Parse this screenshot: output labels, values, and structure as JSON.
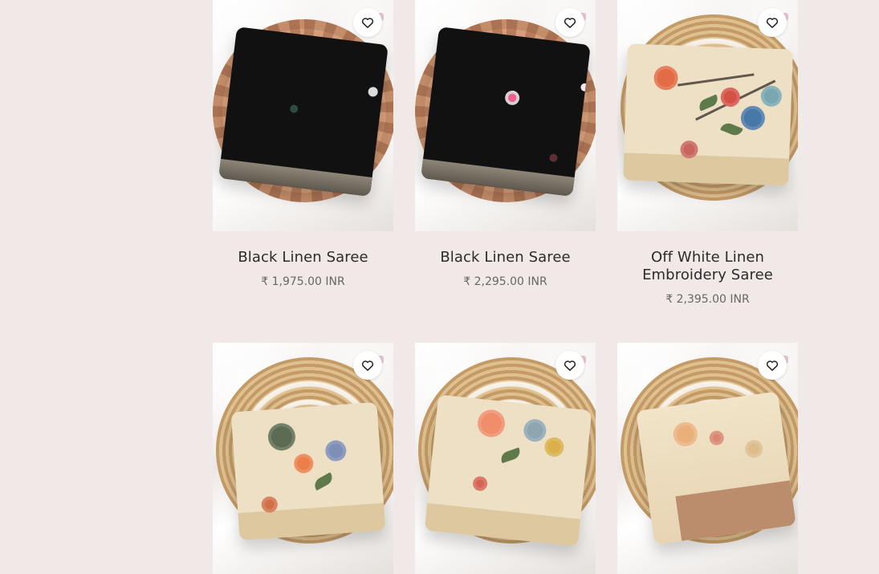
{
  "products": [
    {
      "name": "Black Linen Saree",
      "price": "₹ 1,975.00 INR",
      "wishlist_icon": "heart-outline-icon"
    },
    {
      "name": "Black Linen Saree",
      "price": "₹ 2,295.00 INR",
      "wishlist_icon": "heart-outline-icon"
    },
    {
      "name": "Off White Linen Embroidery Saree",
      "price": "₹ 2,395.00 INR",
      "wishlist_icon": "heart-outline-icon"
    },
    {
      "wishlist_icon": "heart-outline-icon"
    },
    {
      "wishlist_icon": "heart-outline-icon"
    },
    {
      "wishlist_icon": "heart-outline-icon"
    }
  ],
  "colors": {
    "page_background": "#f1e8e8",
    "text_primary": "#2e2a2a",
    "text_secondary": "#6a6666",
    "wishlist_background": "#ffffff"
  }
}
